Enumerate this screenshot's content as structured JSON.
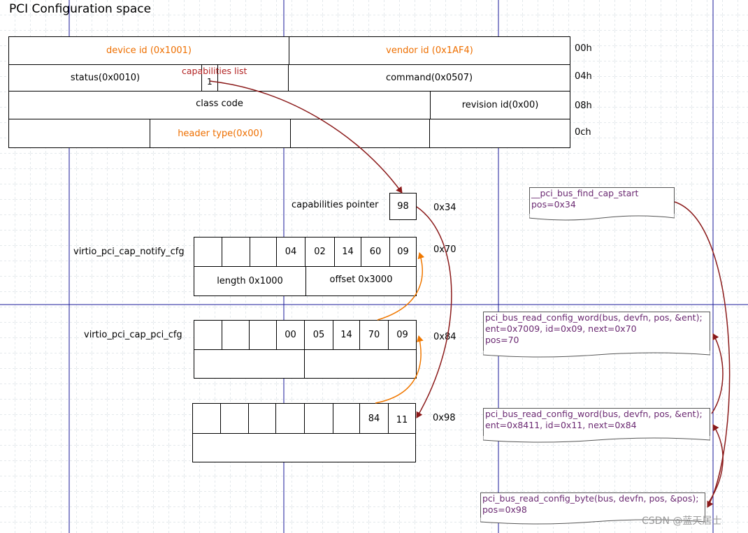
{
  "title": "PCI Configuration space",
  "header": {
    "device_id": "device id (0x1001)",
    "vendor_id": "vendor id (0x1AF4)",
    "status": "status(0x0010)",
    "command": "command(0x0507)",
    "class_code": "class code",
    "revision_id": "revision id(0x00)",
    "header_type": "header type(0x00)",
    "capabilities_list_label": "capabilities list",
    "capabilities_list_bit": "1",
    "offsets": [
      "00h",
      "04h",
      "08h",
      "0ch"
    ]
  },
  "cap_pointer": {
    "label": "capabilities pointer",
    "value": "98",
    "offset": "0x34"
  },
  "notify_cfg": {
    "label": "virtio_pci_cap_notify_cfg",
    "offset": "0x70",
    "bytes": [
      "",
      "",
      "",
      "04",
      "02",
      "14",
      "60",
      "09"
    ],
    "length": "length 0x1000",
    "off": "offset 0x3000"
  },
  "pci_cfg": {
    "label": "virtio_pci_cap_pci_cfg",
    "offset": "0x84",
    "bytes": [
      "",
      "",
      "",
      "00",
      "05",
      "14",
      "70",
      "09"
    ]
  },
  "cap98": {
    "offset": "0x98",
    "bytes": [
      "",
      "",
      "",
      "",
      "",
      "",
      "84",
      "11"
    ]
  },
  "notes": {
    "find_cap_start": [
      "__pci_bus_find_cap_start",
      "pos=0x34"
    ],
    "read_word_70": [
      "pci_bus_read_config_word(bus, devfn, pos, &ent);",
      "ent=0x7009, id=0x09, next=0x70",
      "pos=70"
    ],
    "read_word_84": [
      "pci_bus_read_config_word(bus, devfn, pos, &ent);",
      "ent=0x8411, id=0x11, next=0x84"
    ],
    "read_byte": [
      "pci_bus_read_config_byte(bus, devfn, pos, &pos);",
      "pos=0x98"
    ]
  },
  "watermark": "CSDN @蓝天居士",
  "colors": {
    "orange_text": "#ee6f00",
    "arrow_red": "#8b1a1a",
    "arrow_orange": "#f07800",
    "guide_blue": "#1a1a99",
    "note_text": "#6b2a72"
  }
}
